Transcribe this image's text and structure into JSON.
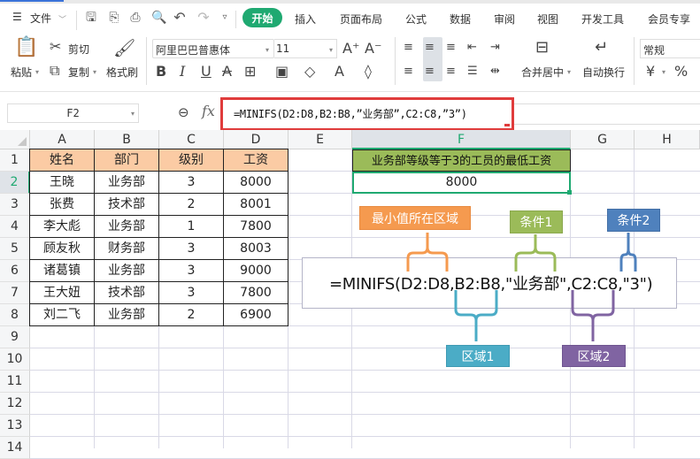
{
  "menu": {
    "file_label": "文件",
    "tabs": [
      "开始",
      "插入",
      "页面布局",
      "公式",
      "数据",
      "审阅",
      "视图",
      "开发工具",
      "会员专享"
    ],
    "active_tab": "开始"
  },
  "quick_access": [
    "save-icon",
    "export-icon",
    "print-icon",
    "print-preview-icon",
    "undo-icon",
    "redo-icon",
    "more-icon"
  ],
  "ribbon": {
    "paste_label": "粘贴",
    "cut_label": "剪切",
    "copy_label": "复制",
    "format_painter_label": "格式刷",
    "font_name": "阿里巴巴普惠体",
    "font_size": "11",
    "merge_center_label": "合并居中",
    "wrap_text_label": "自动换行",
    "number_format": "常规",
    "currency_symbol": "¥",
    "percent_symbol": "%"
  },
  "formula_bar": {
    "name_box": "F2",
    "fx_label": "fx",
    "formula": "=MINIFS(D2:D8,B2:B8,”业务部”,C2:C8,”3”)"
  },
  "sheet": {
    "columns": [
      "A",
      "B",
      "C",
      "D",
      "E",
      "F",
      "G",
      "H"
    ],
    "selected_column": "F",
    "rows": [
      "1",
      "2",
      "3",
      "4",
      "5",
      "6",
      "7",
      "8",
      "9",
      "10",
      "11",
      "12",
      "13",
      "14"
    ],
    "selected_row": "2",
    "table_header": [
      "姓名",
      "部门",
      "级别",
      "工资"
    ],
    "table_rows": [
      [
        "王晓",
        "业务部",
        "3",
        "8000"
      ],
      [
        "张费",
        "技术部",
        "2",
        "8001"
      ],
      [
        "李大彪",
        "业务部",
        "1",
        "7800"
      ],
      [
        "顾友秋",
        "财务部",
        "3",
        "8003"
      ],
      [
        "诸葛镇",
        "业务部",
        "3",
        "9000"
      ],
      [
        "王大妞",
        "技术部",
        "3",
        "7800"
      ],
      [
        "刘二飞",
        "业务部",
        "2",
        "6900"
      ]
    ],
    "result_title": "业务部等级等于3的工员的最低工资",
    "result_value": "8000"
  },
  "annotation": {
    "formula_display": "=MINIFS(D2:D8,B2:B8,\"业务部\",C2:C8,\"3\")",
    "labels": {
      "min_range": "最小值所在区域",
      "criteria1": "条件1",
      "criteria2": "条件2",
      "range1": "区域1",
      "range2": "区域2"
    },
    "colors": {
      "min_range": "#f59a4f",
      "criteria1": "#9bbb59",
      "criteria2": "#4f81bd",
      "range1": "#4bacc6",
      "range2": "#8064a2",
      "header_fill": "#fbcba4",
      "title_fill": "#9bbb59",
      "accent": "#1fa971"
    }
  }
}
